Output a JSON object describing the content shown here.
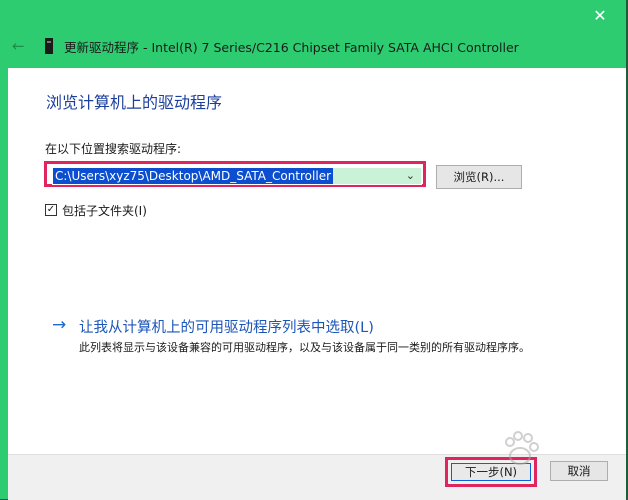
{
  "window": {
    "title": "更新驱动程序 - Intel(R) 7 Series/C216 Chipset Family SATA AHCI Controller",
    "close_glyph": "✕",
    "back_glyph": "←"
  },
  "main": {
    "heading": "浏览计算机上的驱动程序",
    "search_label": "在以下位置搜索驱动程序:",
    "path_value": "C:\\Users\\xyz75\\Desktop\\AMD_SATA_Controller",
    "dropdown_glyph": "⌄",
    "browse_label": "浏览(R)...",
    "include_subfolders_label": "包括子文件夹(I)",
    "include_subfolders_checked": true,
    "check_glyph": "✓",
    "pick_link_arrow": "→",
    "pick_link_label": "让我从计算机上的可用驱动程序列表中选取(L)",
    "pick_link_desc": "此列表将显示与该设备兼容的可用驱动程序，以及与该设备属于同一类别的所有驱动程序序。"
  },
  "footer": {
    "next_label": "下一步(N)",
    "cancel_label": "取消"
  },
  "colors": {
    "titlebar": "#2ecc71",
    "highlight_box": "#e0245e",
    "heading": "#1c3f9e",
    "link": "#1c55b8",
    "selection": "#0b4fd0"
  },
  "icons": [
    "back-arrow-icon",
    "device-icon",
    "close-icon",
    "dropdown-chevron-icon",
    "checkbox-check-icon",
    "link-arrow-icon",
    "watermark-paw-icon"
  ]
}
